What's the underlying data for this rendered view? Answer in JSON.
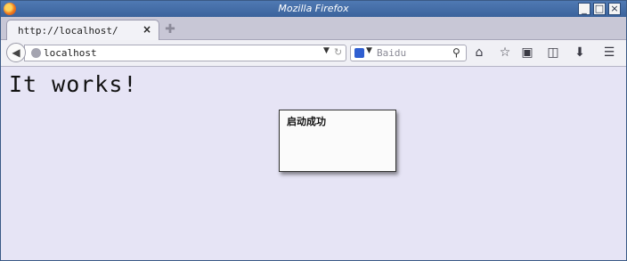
{
  "window": {
    "title": "Mozilla Firefox"
  },
  "tab": {
    "label": "http://localhost/",
    "close": "×"
  },
  "toolbar": {
    "url": "localhost",
    "search_placeholder": "Baidu"
  },
  "icons": {
    "back": "back-arrow-icon",
    "home": "home-icon",
    "bookmark": "star-icon",
    "reading_list": "clipboard-icon",
    "sidebar": "sidebar-icon",
    "downloads": "download-icon",
    "menu": "hamburger-menu-icon"
  },
  "page": {
    "heading": "It works!",
    "popup_message": "启动成功"
  },
  "colors": {
    "page_background": "#e6e4f5",
    "titlebar": "#4f79b3"
  }
}
